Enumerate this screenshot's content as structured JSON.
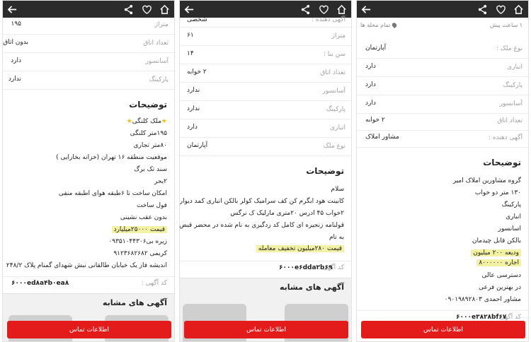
{
  "colors": {
    "topbar": "#2b2b2b",
    "cta": "#e41b1b",
    "highlight": "#f3f2a4"
  },
  "icons": {
    "back": "arrow-left-icon",
    "share": "share-icon",
    "favorite": "heart-icon",
    "home": "home-icon"
  },
  "panel1": {
    "rows": [
      {
        "label": "متراژ",
        "value": "۱۹۵"
      },
      {
        "label": "تعداد اتاق",
        "value": "بدون اتاق"
      },
      {
        "label": "آسانسور",
        "value": "دارد"
      },
      {
        "label": "پارکینگ",
        "value": "ندارد"
      }
    ],
    "description_title": "توضیحات",
    "description": [
      "ملک کلنگی",
      "۱۹۵متر کلنگی",
      "۸۰متر تجاری",
      "موقعیت منطقه ۱۶ تهران (خزانه بخارایی )",
      "سند تک برگ",
      "۲بحر",
      "امکان ساخت تا ۶طبقه هوای اطبقه منفی",
      "فول ساخت",
      "بدون عقب نشینی",
      "قیمت ۲۵۰۰۰میلیارد",
      "زیره بی۰۹۳۵۱۰۴۴۳۰۶",
      "کریمی ۹۱۲۳۶۸۲۶۸۲",
      "اندیشه فاز یک خیابان طالقانی نبش شهدای گمنام پلاک ۲۴۸/۲"
    ],
    "ad_code_label": "کد آگهی :",
    "ad_code": "۶۰۰۰ed۸a۴b۰ea۸",
    "similar_title": "آگهی های مشابه",
    "contact_button": "اطلاعات تماس"
  },
  "panel2": {
    "rows": [
      {
        "label": "آگهی دهنده :",
        "value": "شخصی"
      },
      {
        "label": "متراژ",
        "value": "۶۱"
      },
      {
        "label": "سن بنا :",
        "value": "۱۴"
      },
      {
        "label": "تعداد اتاق",
        "value": "۲ خوابه"
      },
      {
        "label": "آسانسور",
        "value": "ندارد"
      },
      {
        "label": "پارکینگ",
        "value": "ندارد"
      },
      {
        "label": "انباری",
        "value": "دارد"
      },
      {
        "label": "نوع ملک",
        "value": "آپارتمان"
      }
    ],
    "description_title": "توضیحات",
    "description": [
      "سلام",
      "کابینت هود ابگرم کن کف سرامیک کولر بالکن انباری کمد دیواری",
      "۲خواب ۴۵ ادرس ۲۰متری مارلیک ک نرگس",
      "قولنامه زنجیره ای کامل کد ردگیری به نام شده در محضر قبض ها",
      "به نام",
      "قیمت ۲۸۰میلیون تخفیف معامله"
    ],
    "ad_code_label": "کد آگهی :",
    "ad_code": "۶۰۰۰e۶dda۲b۶۹",
    "similar_title": "آگهی های مشابه",
    "contact_button": "اطلاعات تماس"
  },
  "panel3": {
    "time": "۱ ساعت پیش",
    "area": "تمام محله ها",
    "rows": [
      {
        "label": "نوع ملک :",
        "value": "آپارتمان"
      },
      {
        "label": "انباری",
        "value": "دارد"
      },
      {
        "label": "پارکینگ",
        "value": "دارد"
      },
      {
        "label": "آسانسور",
        "value": "دارد"
      },
      {
        "label": "تعداد اتاق",
        "value": "۲ خوابه"
      },
      {
        "label": "آگهی دهنده :",
        "value": "مشاور املاک"
      }
    ],
    "description_title": "توضیحات",
    "description": [
      "گروه مشاورین املاک امیر",
      "۱۳۰ متر دو خواب",
      "پارکینگ",
      "انباری",
      "اسانسور",
      "بالکن قابل چیدمان",
      "ودیعه ۲۰۰ میلیون",
      "اجاره ۸۰۰۰۰۰۰",
      "دسترسی عالی",
      "در بهترین فرعی",
      "مشاور احمدی ۰۹۰۱۹۸۹۲۸۰۳"
    ],
    "ad_code_label": "کد آگهی :",
    "ad_code": "۶۰۰۰e۳۸۲۸bf۶۷",
    "contact_button": "اطلاعات تماس"
  }
}
